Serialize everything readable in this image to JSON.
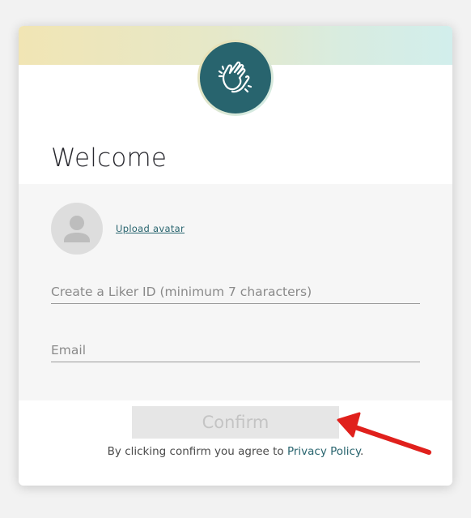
{
  "title": "Welcome",
  "avatar": {
    "icon": "person-icon",
    "upload_label": "Upload avatar"
  },
  "fields": {
    "liker_id": {
      "value": "",
      "placeholder": "Create a Liker ID (minimum 7 characters)"
    },
    "email": {
      "value": "",
      "placeholder": "Email"
    }
  },
  "confirm_label": "Confirm",
  "agreement": {
    "text": "By clicking confirm you agree to ",
    "link": "Privacy Policy",
    "suffix": "."
  },
  "annotation": {
    "icon": "red-arrow-icon",
    "color": "#e0201c"
  },
  "colors": {
    "brand": "#28646e",
    "button_bg": "#e6e6e6",
    "button_text": "#c4c4c4",
    "form_bg": "#f6f6f6"
  },
  "logo": {
    "icon": "clapping-hands-icon"
  }
}
